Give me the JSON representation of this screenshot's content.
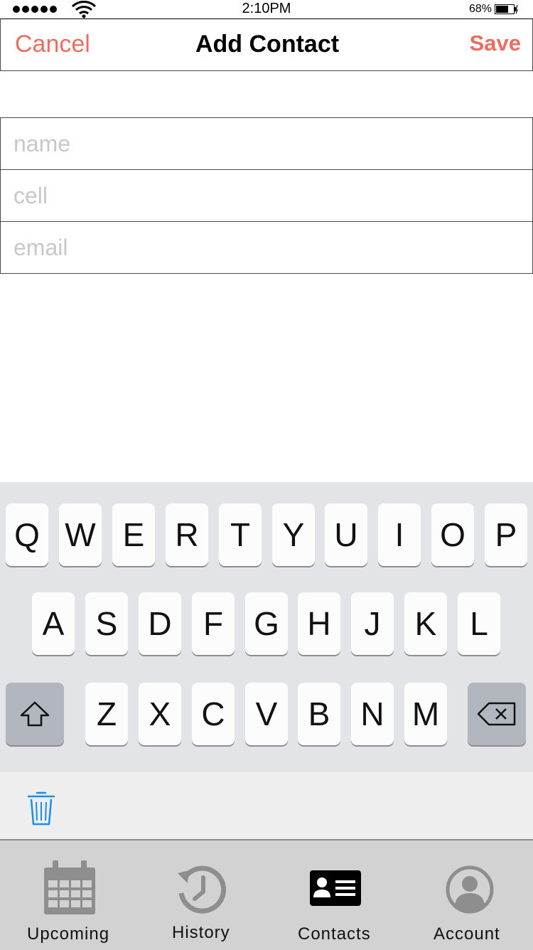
{
  "status_bar": {
    "time": "2:10PM",
    "battery": "68%"
  },
  "nav": {
    "cancel": "Cancel",
    "title": "Add Contact",
    "save": "Save"
  },
  "form": {
    "name_placeholder": "name",
    "cell_placeholder": "cell",
    "email_placeholder": "email"
  },
  "keyboard": {
    "row1": [
      "Q",
      "W",
      "E",
      "R",
      "T",
      "Y",
      "U",
      "I",
      "O",
      "P"
    ],
    "row2": [
      "A",
      "S",
      "D",
      "F",
      "G",
      "H",
      "J",
      "K",
      "L"
    ],
    "row3": [
      "Z",
      "X",
      "C",
      "V",
      "B",
      "N",
      "M"
    ],
    "shift_icon": "shift-icon",
    "delete_icon": "backspace-icon"
  },
  "toolbar": {
    "icon": "trash-icon",
    "accent": "#1a8ee8"
  },
  "tabs": [
    {
      "label": "Upcoming",
      "icon": "calendar-icon"
    },
    {
      "label": "History",
      "icon": "history-icon"
    },
    {
      "label": "Contacts",
      "icon": "contact-card-icon",
      "selected": true
    },
    {
      "label": "Account",
      "icon": "user-icon"
    }
  ],
  "colors": {
    "accent": "#ec6d60",
    "tab_inactive": "#8e8e8e",
    "tab_active": "#000000"
  }
}
